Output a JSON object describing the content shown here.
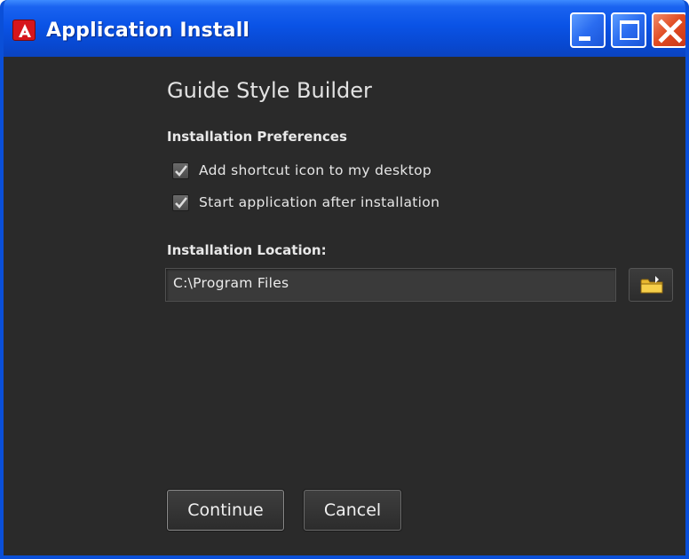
{
  "window": {
    "title": "Application Install",
    "icon": "adobe-air-icon",
    "controls": {
      "minimize_icon": "minimize-icon",
      "maximize_icon": "maximize-icon",
      "close_icon": "close-icon"
    }
  },
  "app": {
    "name": "Guide Style Builder"
  },
  "preferences": {
    "heading": "Installation Preferences",
    "options": [
      {
        "label": "Add shortcut icon to my desktop",
        "checked": true
      },
      {
        "label": "Start application after installation",
        "checked": true
      }
    ]
  },
  "location": {
    "heading": "Installation Location:",
    "value": "C:\\Program Files",
    "browse_icon": "folder-icon"
  },
  "actions": {
    "continue_label": "Continue",
    "cancel_label": "Cancel"
  },
  "colors": {
    "titlebar": "#0a53e6",
    "background": "#2a2a2a",
    "close_button": "#e04a20",
    "text": "#e6e6e6"
  }
}
